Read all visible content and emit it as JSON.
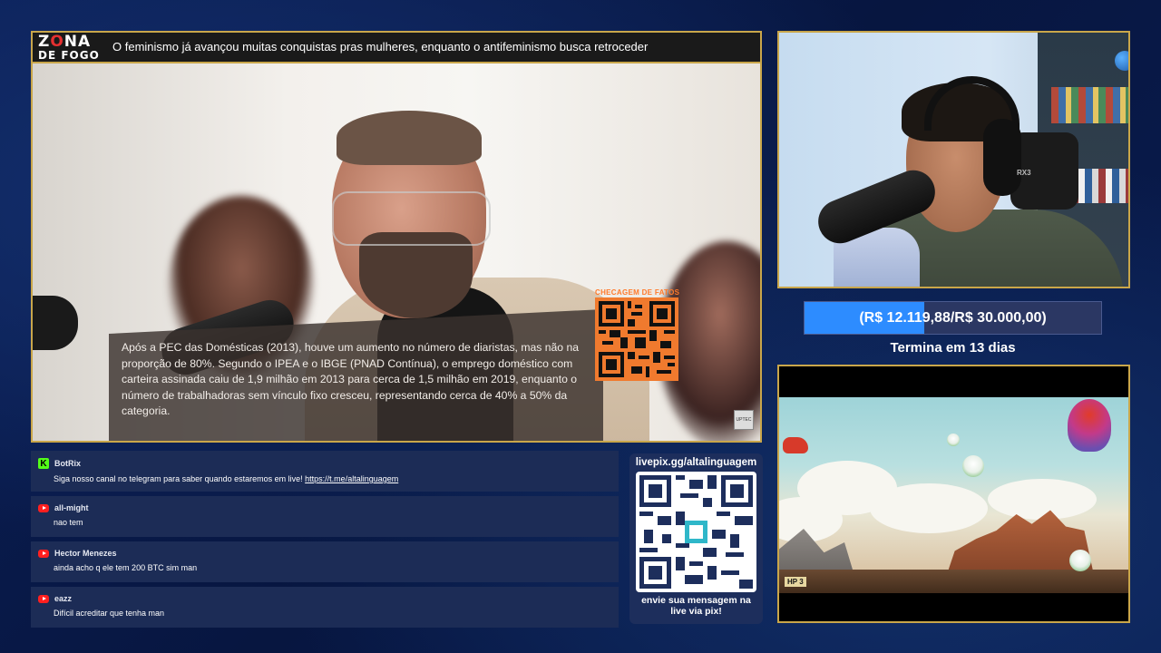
{
  "main_video": {
    "logo_line1_a": "Z",
    "logo_line1_b": "O",
    "logo_line1_c": "NA",
    "logo_line2": "DE FOGO",
    "topic": "O feminismo já avançou muitas conquistas pras mulheres, enquanto o antifeminismo busca retroceder",
    "caption": "Após a PEC das Domésticas (2013), houve um aumento no número de diaristas, mas não na proporção de 80%. Segundo o IPEA e o IBGE (PNAD Contínua), o emprego doméstico com carteira assinada caiu de 1,9 milhão em 2013 para cerca de 1,5 milhão em 2019, enquanto o número de trabalhadoras sem vínculo fixo cresceu, representando cerca de 40% a 50% da categoria.",
    "qr_label": "CHECAGEM DE FATOS",
    "watermark": "UPTEC",
    "accent_color": "#c9a64a",
    "qr_color": "#f07a2e"
  },
  "webcam": {
    "headset_brand": "RX3"
  },
  "goal": {
    "text": "(R$ 12.119,88/R$ 30.000,00)",
    "progress": 0.404,
    "deadline": "Termina em 13 dias",
    "fill_color": "#2d8cff"
  },
  "game": {
    "hud": "HP 3"
  },
  "chat": {
    "messages": [
      {
        "platform": "kick",
        "badge": "K",
        "user": "BotRix",
        "text": "Siga nosso canal no telegram para saber quando estaremos em live! ",
        "link": "https://t.me/altalinguagem"
      },
      {
        "platform": "youtube",
        "user": "all-might",
        "text": "nao tem"
      },
      {
        "platform": "youtube",
        "user": "Hector Menezes",
        "text": "ainda acho q ele tem 200 BTC sim man"
      },
      {
        "platform": "youtube",
        "user": "eazz",
        "text": "Difícil acreditar que tenha man"
      }
    ]
  },
  "pix": {
    "url": "livepix.gg/altalinguagem",
    "cta": "envie sua mensagem na live via pix!"
  }
}
